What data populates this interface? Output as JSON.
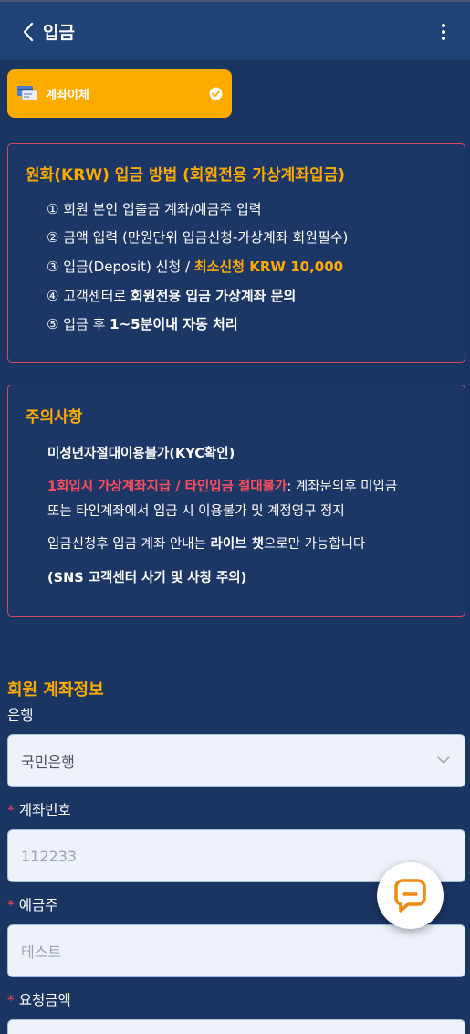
{
  "header": {
    "title": "입금"
  },
  "method_tab": {
    "label": "계좌이체",
    "selected": true
  },
  "deposit_method": {
    "title": "원화(KRW) 입금 방법 (회원전용 가상계좌입금)",
    "steps": [
      {
        "t1": "① 회원 본인 입출금 계좌/예금주 입력"
      },
      {
        "t1": "② 금액 입력 (만원단위 입금신청-가상계좌 회원필수)"
      },
      {
        "t1": "③ 입금(Deposit) 신청 / ",
        "t2": "최소신청 KRW 10,000"
      },
      {
        "t1": "④ 고객센터로 ",
        "t2": "회원전용 입금 가상계좌 문의"
      },
      {
        "t1": "⑤ 입금 후 ",
        "t2": "1~5분이내 자동 처리"
      }
    ]
  },
  "caution": {
    "title": "주의사항",
    "line1": "미성년자절대이용불가(KYC확인)",
    "line2_red": "1회입시 가상계좌지급 / 타인입금 절대불가",
    "line2_rest": ": 계좌문의후 미입금",
    "line3": "또는 타인계좌에서 입금 시 이용불가 및 계정영구 정지",
    "line4_a": "입금신청후 입금 계좌 안내는 ",
    "line4_b": "라이브 챗",
    "line4_c": "으로만 가능합니다",
    "line5": "(SNS 고객센터 사기 및 사칭 주의)"
  },
  "account_info": {
    "title": "회원 계좌정보",
    "bank_label": "은행",
    "bank_value": "국민은행",
    "required_mark": "*",
    "account_label": "계좌번호",
    "account_placeholder": "112233",
    "holder_label": "예금주",
    "holder_placeholder": "테스트",
    "amount_label": "요청금액"
  },
  "colors": {
    "background": "#1b3563",
    "header": "#1f4277",
    "accent": "#fdab00",
    "warning": "#ff4d5d",
    "box_border": "#d9485a"
  }
}
